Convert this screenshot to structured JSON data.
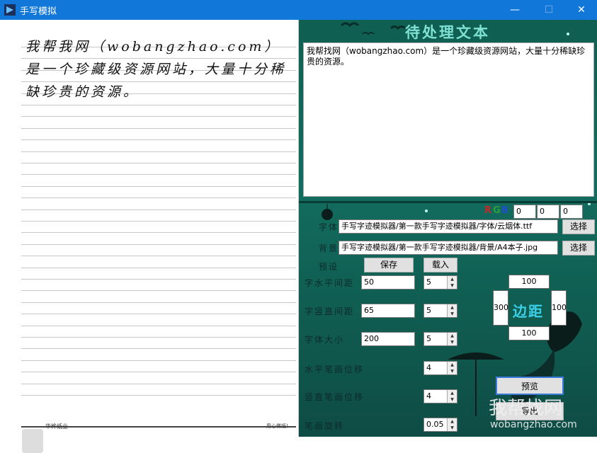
{
  "window": {
    "title": "手写模拟",
    "minimize_glyph": "—",
    "maximize_glyph": "☐",
    "close_glyph": "✕"
  },
  "paper": {
    "handwriting": "我帮我网（wobangzhao.com）是一个珍藏级资源网站，大量十分稀缺珍贵的资源。",
    "footer_left": "华桦纸业",
    "footer_right": "用心做纸！"
  },
  "panel": {
    "title": "待处理文本",
    "input_text": "我帮找网（wobangzhao.com）是一个珍藏级资源网站，大量十分稀缺珍贵的资源。",
    "rgb_r": "R",
    "rgb_g": "G",
    "rgb_b": "B",
    "rgb_values": [
      "0",
      "0",
      "0"
    ],
    "font_label": "字体",
    "font_path": "手写字迹模拟器/第一款手写字迹模拟器/字体/云烟体.ttf",
    "font_select": "选择",
    "bg_label": "背景",
    "bg_path": "手写字迹模拟器/第一款手写字迹模拟器/背景/A4本子.jpg",
    "bg_select": "选择",
    "preset_label": "预设",
    "save": "保存",
    "load": "载入",
    "h_spacing_label": "字水平间距",
    "h_spacing_value": "50",
    "h_spacing_step": "5",
    "v_spacing_label": "字竖直间距",
    "v_spacing_value": "65",
    "v_spacing_step": "5",
    "font_size_label": "字体大小",
    "font_size_value": "200",
    "font_size_step": "5",
    "h_offset_label": "水平笔画位移",
    "h_offset_value": "4",
    "v_offset_label": "竖直笔画位移",
    "v_offset_value": "4",
    "rotation_label": "笔画旋转",
    "rotation_value": "0.05",
    "margin_top": "100",
    "margin_left": "300",
    "margin_right": "100",
    "margin_bottom": "100",
    "margin_label": "边距",
    "preview": "预览",
    "export": "导出",
    "watermark": "我帮找网",
    "watermark_url": "wobangzhao.com"
  }
}
